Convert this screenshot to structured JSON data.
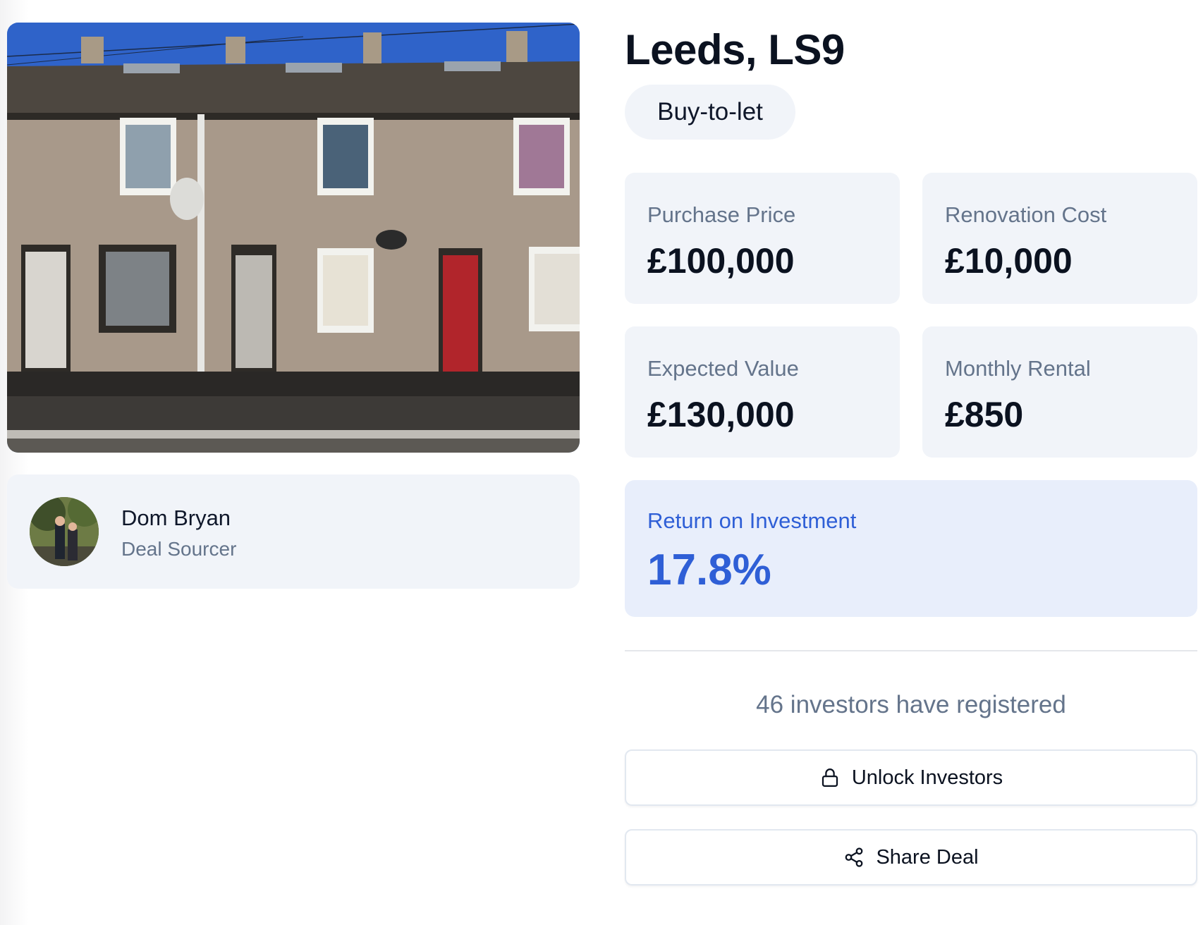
{
  "listing": {
    "title": "Leeds, LS9",
    "tag": "Buy-to-let"
  },
  "sourcer": {
    "name": "Dom Bryan",
    "role": "Deal Sourcer"
  },
  "stats": [
    {
      "label": "Purchase Price",
      "value": "£100,000"
    },
    {
      "label": "Renovation Cost",
      "value": "£10,000"
    },
    {
      "label": "Expected Value",
      "value": "£130,000"
    },
    {
      "label": "Monthly Rental",
      "value": "£850"
    }
  ],
  "roi": {
    "label": "Return on Investment",
    "value": "17.8%"
  },
  "investors": {
    "registered_text": "46 investors have registered"
  },
  "actions": {
    "unlock_label": "Unlock Investors",
    "share_label": "Share Deal"
  },
  "icons": {
    "unlock": "lock-icon",
    "share": "share-icon"
  },
  "colors": {
    "accent": "#2f5fd6",
    "card_bg": "#f1f4f9",
    "roi_bg": "#e8eefb",
    "muted_text": "#64748b"
  }
}
